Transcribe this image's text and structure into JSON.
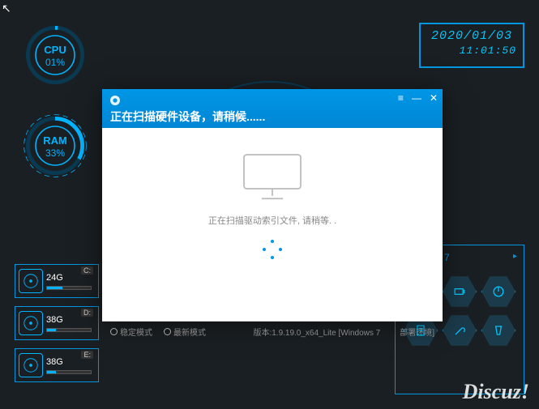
{
  "gauges": {
    "cpu": {
      "label": "CPU",
      "value": "01%",
      "pct": 1
    },
    "ram": {
      "label": "RAM",
      "value": "33%",
      "pct": 33
    }
  },
  "clock": {
    "date": "2020/01/03",
    "time": "11:01:50"
  },
  "disks": [
    {
      "letter": "C:",
      "size": "24G",
      "used_pct": 35
    },
    {
      "letter": "D:",
      "size": "38G",
      "used_pct": 20
    },
    {
      "letter": "E:",
      "size": "38G",
      "used_pct": 20
    }
  ],
  "hex_panel": {
    "title": "Windows 7"
  },
  "dialog": {
    "title": "正在扫描硬件设备，请稍候......",
    "scan_text": "正在扫描驱动索引文件, 请稍等. .",
    "radio1": "稳定模式",
    "radio2": "最新模式",
    "version": "版本:1.9.19.0_x64_Lite [Windows 7",
    "env": "部署环境]"
  },
  "watermark": "Discuz!"
}
